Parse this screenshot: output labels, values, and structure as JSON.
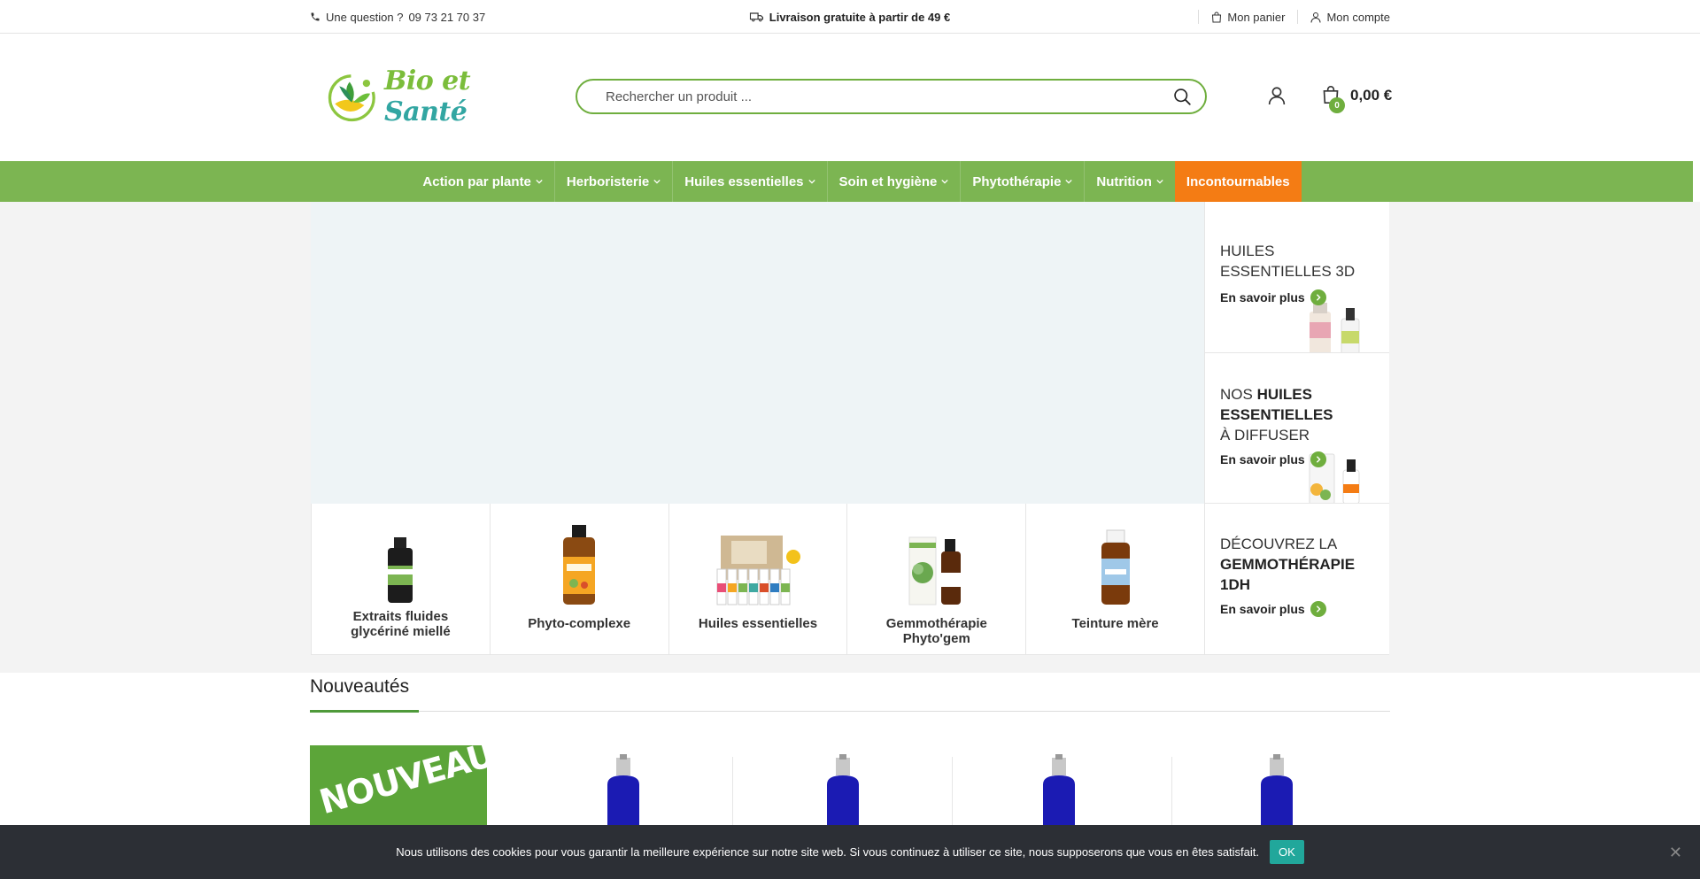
{
  "topbar": {
    "question_label": "Une question ?",
    "phone": "09 73 21 70 37",
    "shipping": "Livraison gratuite à partir de 49 €",
    "cart_link": "Mon panier",
    "account_link": "Mon compte"
  },
  "header": {
    "logo_text_1": "Bio et",
    "logo_text_2": "Santé",
    "search_placeholder": "Rechercher un produit ...",
    "cart_count": "0",
    "cart_total": "0,00 €"
  },
  "nav": {
    "items": [
      {
        "label": "Action par plante",
        "has_dropdown": true
      },
      {
        "label": "Herboristerie",
        "has_dropdown": true
      },
      {
        "label": "Huiles essentielles",
        "has_dropdown": true
      },
      {
        "label": "Soin et hygiène",
        "has_dropdown": true
      },
      {
        "label": "Phytothérapie",
        "has_dropdown": true
      },
      {
        "label": "Nutrition",
        "has_dropdown": true
      },
      {
        "label": "Incontournables",
        "has_dropdown": false,
        "highlight_color": "#f47c14"
      }
    ]
  },
  "promos": [
    {
      "title_line1": "HUILES",
      "title_line2": "ESSENTIELLES 3D",
      "more": "En savoir plus"
    },
    {
      "title_pre": "NOS",
      "title_bold1": "HUILES",
      "title_bold2": "ESSENTIELLES",
      "title_line3": "À DIFFUSER",
      "more": "En savoir plus"
    },
    {
      "title_line1": "DÉCOUVREZ LA",
      "title_bold1": "GEMMOTHÉRAPIE",
      "title_bold2": "1DH",
      "more": "En savoir plus"
    }
  ],
  "categories": [
    {
      "label": "Extraits fluides glycériné miellé"
    },
    {
      "label": "Phyto-complexe"
    },
    {
      "label": "Huiles essentielles"
    },
    {
      "label": "Gemmothérapie Phyto'gem"
    },
    {
      "label": "Teinture mère"
    }
  ],
  "new_section": {
    "title": "Nouveautés",
    "banner": "NOUVEAU"
  },
  "cookie": {
    "message": "Nous utilisons des cookies pour vous garantir la meilleure expérience sur notre site web. Si vous continuez à utiliser ce site, nous supposerons que vous en êtes satisfait.",
    "ok": "OK",
    "close": "✕"
  },
  "colors": {
    "brand_green": "#7cb552",
    "accent_orange": "#f47c14",
    "cookie_bg": "#2c2f35",
    "cookie_ok": "#21a79b"
  }
}
